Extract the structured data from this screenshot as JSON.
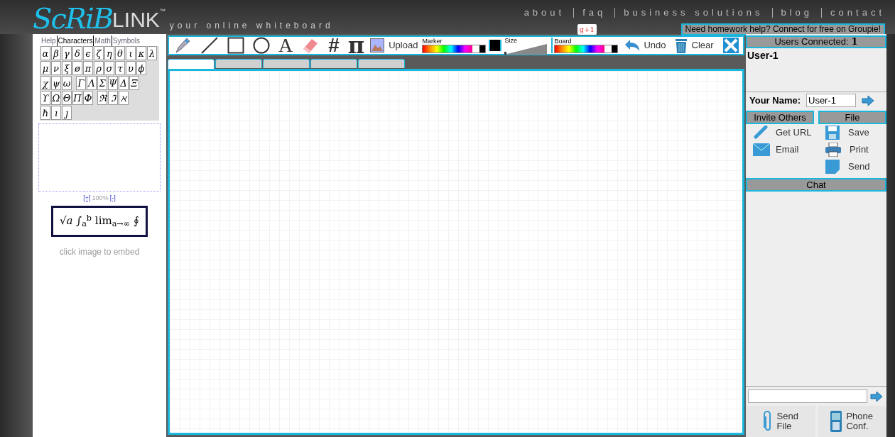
{
  "header": {
    "logo_script": "ScRiB",
    "logo_text": "LINK",
    "trademark": "™",
    "tagline": "your online whiteboard",
    "nav": [
      "about",
      "faq",
      "business solutions",
      "blog",
      "contact"
    ],
    "plus_badge": "g+1",
    "banner": "Need homework help? Connect for free on Groupie!"
  },
  "left_panel": {
    "tabs": [
      {
        "label": "Help",
        "selected": false
      },
      {
        "label": "Characters",
        "selected": true
      },
      {
        "label": "Math",
        "selected": false
      },
      {
        "label": "Symbols",
        "selected": false
      }
    ],
    "symbol_rows": [
      [
        [
          "α",
          "β",
          "γ",
          "δ",
          "ϵ",
          "ζ",
          "η",
          "θ",
          "ι",
          "κ",
          "λ"
        ]
      ],
      [
        [
          "μ",
          "ν",
          "ξ",
          "ø",
          "π",
          "ρ",
          "σ",
          "τ",
          "υ",
          "ϕ"
        ]
      ],
      [
        [
          "χ",
          "ψ",
          "ω"
        ],
        [
          "Γ",
          "Λ",
          "Σ",
          "Ψ",
          "Δ",
          "Ξ"
        ]
      ],
      [
        [
          "ϒ",
          "Ω",
          "Θ",
          "Π",
          "Φ"
        ],
        [
          "ℜ",
          "ℑ",
          "ℵ"
        ]
      ],
      [
        [
          "ℏ",
          "ı",
          "ȷ"
        ]
      ]
    ],
    "zoom_in": "[+]",
    "zoom_level": "100%",
    "zoom_out": "[-]",
    "formula": "√*a* ∫$_{a}$$^{b}$ lim$_{a→∞}$ ∮",
    "embed_hint": "click image to embed"
  },
  "toolbar": {
    "tools": [
      {
        "kind": "pen"
      },
      {
        "kind": "line"
      },
      {
        "kind": "rectangle"
      },
      {
        "kind": "circle"
      },
      {
        "kind": "text",
        "glyph": "A"
      },
      {
        "kind": "eraser"
      },
      {
        "kind": "grid",
        "glyph": "#"
      },
      {
        "kind": "pi",
        "glyph": "π"
      }
    ],
    "upload": "Upload",
    "marker": {
      "label": "Marker",
      "color": "#000000"
    },
    "size": {
      "label": "Size",
      "level": 0.05
    },
    "board": {
      "label": "Board"
    },
    "undo": "Undo",
    "clear": "Clear"
  },
  "canvas_tabs": [
    {
      "selected": true
    },
    {
      "selected": false
    },
    {
      "selected": false
    },
    {
      "selected": false
    },
    {
      "selected": false
    }
  ],
  "right_panel": {
    "users_title": "Users Connected:",
    "users_count": "1",
    "users": [
      "User-1"
    ],
    "name_label": "Your Name:",
    "name_value": "User-1",
    "invite_title": "Invite Others",
    "invite": [
      "Get URL",
      "Email"
    ],
    "file_title": "File",
    "file": [
      "Save",
      "Print",
      "Send"
    ],
    "chat_title": "Chat",
    "send_file": [
      "Send",
      "File"
    ],
    "phone": [
      "Phone",
      "Conf."
    ]
  }
}
